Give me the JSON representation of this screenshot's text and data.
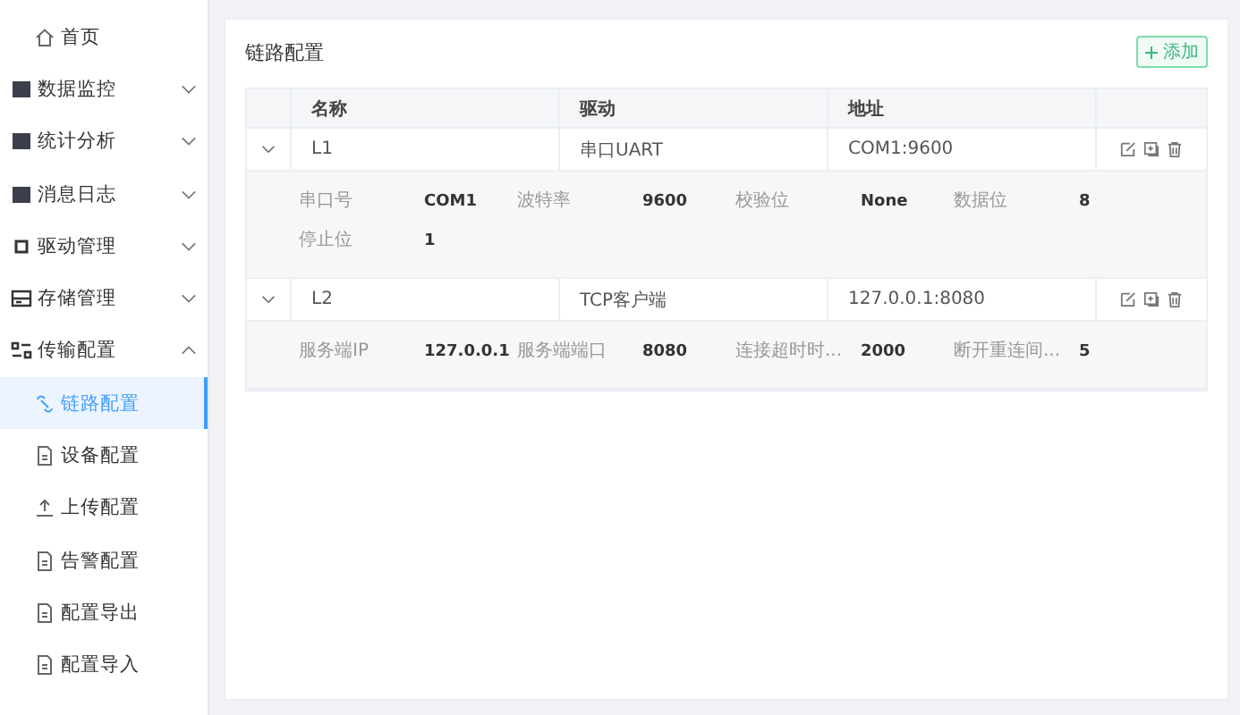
{
  "sidebar": {
    "items": [
      {
        "label": "首页",
        "selected": false
      },
      {
        "label": "数据监控",
        "expanded": false,
        "selected": false
      },
      {
        "label": "统计分析",
        "expanded": false,
        "selected": false
      },
      {
        "label": "消息日志",
        "expanded": false,
        "selected": false
      },
      {
        "label": "驱动管理",
        "expanded": false,
        "selected": false
      },
      {
        "label": "存储管理",
        "expanded": false,
        "selected": false
      },
      {
        "label": "传输配置",
        "expanded": true,
        "selected": false,
        "children": [
          {
            "label": "链路配置",
            "selected": true
          },
          {
            "label": "设备配置",
            "selected": false
          },
          {
            "label": "上传配置",
            "selected": false
          },
          {
            "label": "告警配置",
            "selected": false
          },
          {
            "label": "配置导出",
            "selected": false
          },
          {
            "label": "配置导入",
            "selected": false
          }
        ]
      }
    ]
  },
  "page": {
    "title": "链路配置",
    "add_button": "添加"
  },
  "table": {
    "columns": [
      "名称",
      "驱动",
      "地址"
    ],
    "rows": [
      {
        "name": "L1",
        "driver": "串口UART",
        "address": "COM1:9600",
        "expanded": true,
        "details": [
          {
            "label": "串口号",
            "value": "COM1"
          },
          {
            "label": "波特率",
            "value": "9600"
          },
          {
            "label": "校验位",
            "value": "None"
          },
          {
            "label": "数据位",
            "value": "8"
          },
          {
            "label": "停止位",
            "value": "1"
          }
        ]
      },
      {
        "name": "L2",
        "driver": "TCP客户端",
        "address": "127.0.0.1:8080",
        "expanded": true,
        "details": [
          {
            "label": "服务端IP",
            "value": "127.0.0.1"
          },
          {
            "label": "服务端端口",
            "value": "8080"
          },
          {
            "label": "连接超时时...",
            "value": "2000"
          },
          {
            "label": "断开重连间...",
            "value": "5"
          }
        ]
      }
    ]
  }
}
